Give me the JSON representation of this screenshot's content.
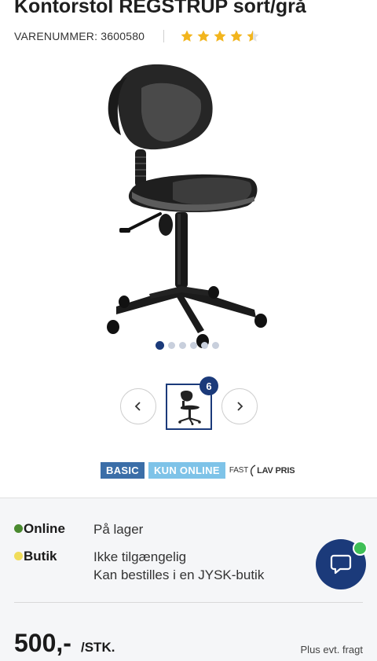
{
  "product": {
    "title": "Kontorstol REGSTRUP sort/grå",
    "sku": "VARENUMMER: 3600580",
    "rating": 4.5,
    "rating_max": 5
  },
  "gallery": {
    "image_icon": "office-chair-image",
    "slide_count": 6,
    "active_slide": 1,
    "thumb_badge": "6",
    "prev_icon": "chevron-left-icon",
    "next_icon": "chevron-right-icon"
  },
  "badges": {
    "basic": "BASIC",
    "online": "KUN ONLINE",
    "fast_word": "FAST",
    "lavpris": "LAV PRIS"
  },
  "stock": {
    "online_label": "Online",
    "online_status": "På lager",
    "online_color": "#4a8a2f",
    "store_label": "Butik",
    "store_status_1": "Ikke tilgængelig",
    "store_status_2": "Kan bestilles i en JYSK-butik",
    "store_color": "#f0dc5a"
  },
  "chat": {
    "icon": "chat-bubble-icon",
    "status_color": "#3fbf56"
  },
  "price": {
    "amount": "500,-",
    "unit": "/STK.",
    "freight_note": "Plus evt. fragt"
  },
  "colors": {
    "brand": "#1b3a7a",
    "star": "#f2b51d"
  }
}
